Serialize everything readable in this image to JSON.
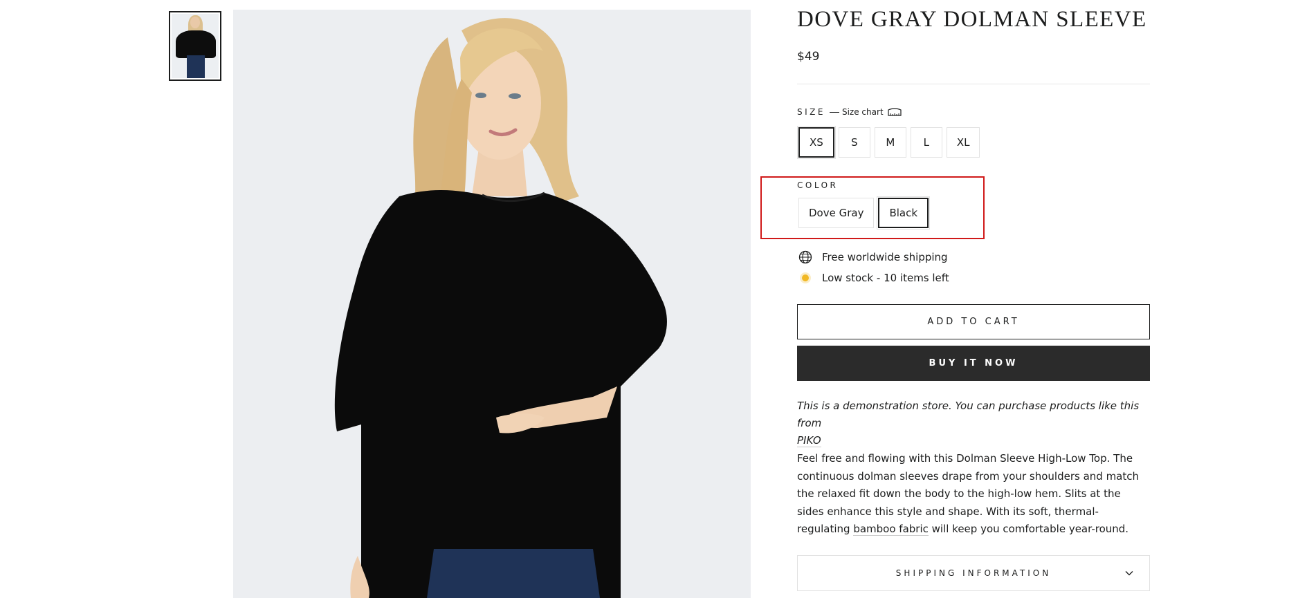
{
  "product": {
    "title": "DOVE GRAY DOLMAN SLEEVE",
    "price": "$49"
  },
  "size": {
    "label": "SIZE",
    "size_chart_label": "Size chart",
    "size_chart_icon": "ruler-icon",
    "options": [
      "XS",
      "S",
      "M",
      "L",
      "XL"
    ],
    "selected": "XS"
  },
  "color": {
    "label": "COLOR",
    "options": [
      "Dove Gray",
      "Black"
    ],
    "selected": "Black"
  },
  "highlight_color": "#d01919",
  "notices": {
    "shipping": "Free worldwide shipping",
    "shipping_icon": "globe-icon",
    "stock": "Low stock - 10 items left",
    "stock_icon": "stock-dot-icon",
    "stock_color": "#f1b824"
  },
  "buttons": {
    "add_to_cart": "ADD TO CART",
    "buy_now": "BUY IT NOW"
  },
  "demo_note": {
    "text": "This is a demonstration store. You can purchase products like this from",
    "link": "PIKO"
  },
  "description": {
    "text_before": "Feel free and flowing with this Dolman Sleeve High-Low Top. The continuous dolman sleeves drape from your shoulders and match the relaxed fit down the body to the high-low hem. Slits at the sides enhance this style and shape. With its soft, thermal-regulating ",
    "link": "bamboo fabric",
    "text_after": " will keep you comfortable year-round."
  },
  "accordion": {
    "label": "SHIPPING INFORMATION",
    "icon": "chevron-down-icon"
  }
}
